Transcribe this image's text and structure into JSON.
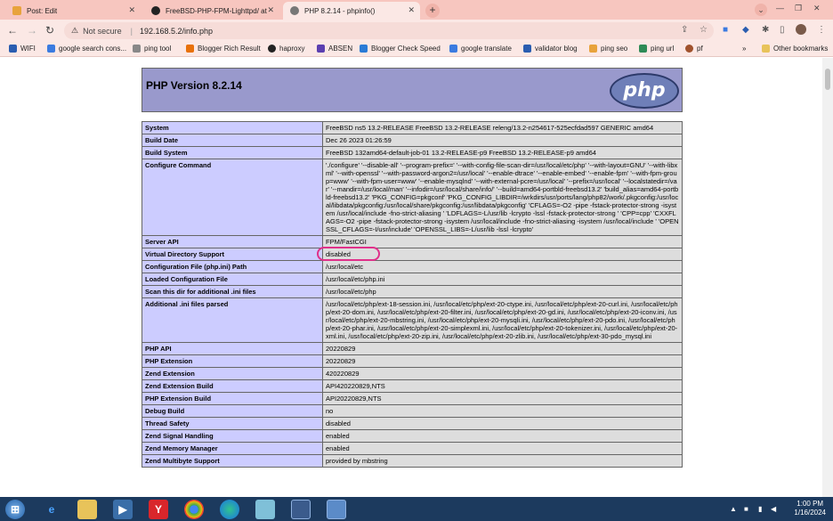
{
  "tabs": [
    {
      "label": "Post: Edit",
      "favicon_color": "#e8a33c"
    },
    {
      "label": "FreeBSD-PHP-FPM-Lighttpd/ at",
      "favicon_color": "#222222"
    },
    {
      "label": "PHP 8.2.14 - phpinfo()",
      "favicon_color": "#777777"
    }
  ],
  "address_bar": {
    "security": "Not secure",
    "url": "192.168.5.2/info.php"
  },
  "bookmarks": [
    {
      "label": "WIFI",
      "color": "#2a5db0"
    },
    {
      "label": "google search cons...",
      "color": "#3b7be0"
    },
    {
      "label": "ping tool",
      "color": "#888888"
    },
    {
      "label": "Blogger Rich Result",
      "color": "#e8710a"
    },
    {
      "label": "haproxy",
      "color": "#222222"
    },
    {
      "label": "ABSEN",
      "color": "#5b3fb0"
    },
    {
      "label": "Blogger Check Speed",
      "color": "#2a7bd6"
    },
    {
      "label": "google translate",
      "color": "#3b7be0"
    },
    {
      "label": "validator blog",
      "color": "#2a5db0"
    },
    {
      "label": "ping seo",
      "color": "#e8a33c"
    },
    {
      "label": "ping url",
      "color": "#2e8b57"
    },
    {
      "label": "pf",
      "color": "#a0522d"
    }
  ],
  "other_bookmarks": "Other bookmarks",
  "page_title": "PHP Version 8.2.14",
  "logo_text": "php",
  "rows": [
    {
      "key": "System",
      "value": "FreeBSD ns5 13.2-RELEASE FreeBSD 13.2-RELEASE releng/13.2-n254617-525ecfdad597 GENERIC amd64"
    },
    {
      "key": "Build Date",
      "value": "Dec 26 2023 01:26:59"
    },
    {
      "key": "Build System",
      "value": "FreeBSD 132amd64-default-job-01 13.2-RELEASE-p9 FreeBSD 13.2-RELEASE-p9 amd64"
    },
    {
      "key": "Configure Command",
      "value": "'./configure' '--disable-all' '--program-prefix=' '--with-config-file-scan-dir=/usr/local/etc/php' '--with-layout=GNU' '--with-libxml' '--with-openssl' '--with-password-argon2=/usr/local' '--enable-dtrace' '--enable-embed' '--enable-fpm' '--with-fpm-group=www' '--with-fpm-user=www' '--enable-mysqlnd' '--with-external-pcre=/usr/local' '--prefix=/usr/local' '--localstatedir=/var' '--mandir=/usr/local/man' '--infodir=/usr/local/share/info/' '--build=amd64-portbld-freebsd13.2' 'build_alias=amd64-portbld-freebsd13.2' 'PKG_CONFIG=pkgconf' 'PKG_CONFIG_LIBDIR=/wrkdirs/usr/ports/lang/php82/work/.pkgconfig:/usr/local/libdata/pkgconfig:/usr/local/share/pkgconfig:/usr/libdata/pkgconfig' 'CFLAGS=-O2 -pipe -fstack-protector-strong -isystem /usr/local/include -fno-strict-aliasing ' 'LDFLAGS=-L/usr/lib -lcrypto -lssl -fstack-protector-strong ' 'CPP=cpp' 'CXXFLAGS=-O2 -pipe -fstack-protector-strong -isystem /usr/local/include -fno-strict-aliasing -isystem /usr/local/include ' 'OPENSSL_CFLAGS=-I/usr/include' 'OPENSSL_LIBS=-L/usr/lib -lssl -lcrypto'"
    },
    {
      "key": "Server API",
      "value": "FPM/FastCGI"
    },
    {
      "key": "Virtual Directory Support",
      "value": "disabled"
    },
    {
      "key": "Configuration File (php.ini) Path",
      "value": "/usr/local/etc"
    },
    {
      "key": "Loaded Configuration File",
      "value": "/usr/local/etc/php.ini"
    },
    {
      "key": "Scan this dir for additional .ini files",
      "value": "/usr/local/etc/php"
    },
    {
      "key": "Additional .ini files parsed",
      "value": "/usr/local/etc/php/ext-18-session.ini, /usr/local/etc/php/ext-20-ctype.ini, /usr/local/etc/php/ext-20-curl.ini, /usr/local/etc/php/ext-20-dom.ini, /usr/local/etc/php/ext-20-filter.ini, /usr/local/etc/php/ext-20-gd.ini, /usr/local/etc/php/ext-20-iconv.ini, /usr/local/etc/php/ext-20-mbstring.ini, /usr/local/etc/php/ext-20-mysqli.ini, /usr/local/etc/php/ext-20-pdo.ini, /usr/local/etc/php/ext-20-phar.ini, /usr/local/etc/php/ext-20-simplexml.ini, /usr/local/etc/php/ext-20-tokenizer.ini, /usr/local/etc/php/ext-20-xml.ini, /usr/local/etc/php/ext-20-zip.ini, /usr/local/etc/php/ext-20-zlib.ini, /usr/local/etc/php/ext-30-pdo_mysql.ini"
    },
    {
      "key": "PHP API",
      "value": "20220829"
    },
    {
      "key": "PHP Extension",
      "value": "20220829"
    },
    {
      "key": "Zend Extension",
      "value": "420220829"
    },
    {
      "key": "Zend Extension Build",
      "value": "API420220829,NTS"
    },
    {
      "key": "PHP Extension Build",
      "value": "API20220829,NTS"
    },
    {
      "key": "Debug Build",
      "value": "no"
    },
    {
      "key": "Thread Safety",
      "value": "disabled"
    },
    {
      "key": "Zend Signal Handling",
      "value": "enabled"
    },
    {
      "key": "Zend Memory Manager",
      "value": "enabled"
    },
    {
      "key": "Zend Multibyte Support",
      "value": "provided by mbstring"
    }
  ],
  "taskbar": {
    "time": "1:00 PM",
    "date": "1/16/2024"
  },
  "colors": {
    "php_header": "#9999cc",
    "row_key": "#ccccff",
    "row_value": "#dddddd",
    "annotation": "#e0308a",
    "chrome": "#f7c6bf"
  }
}
